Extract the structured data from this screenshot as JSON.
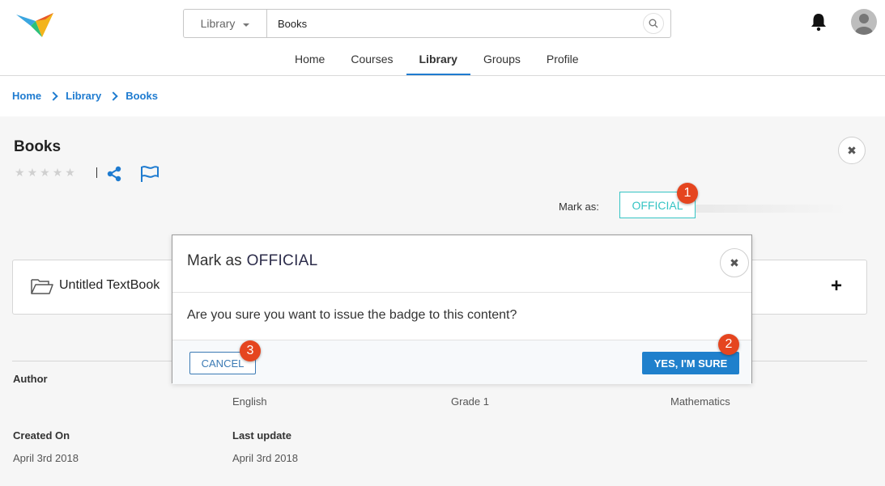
{
  "search": {
    "scope": "Library",
    "query": "Books"
  },
  "nav": {
    "items": [
      "Home",
      "Courses",
      "Library",
      "Groups",
      "Profile"
    ],
    "active": "Library"
  },
  "breadcrumb": [
    "Home",
    "Library",
    "Books"
  ],
  "content": {
    "title": "Books",
    "rating": 0,
    "rating_max": 5,
    "mark_as_label": "Mark as:",
    "badge": "OFFICIAL"
  },
  "card": {
    "title": "Untitled TextBook",
    "add_icon": "plus-icon"
  },
  "meta": {
    "author_label": "Author",
    "language": "English",
    "grade": "Grade 1",
    "subject": "Mathematics",
    "created_label": "Created On",
    "created_value": "April 3rd 2018",
    "updated_label": "Last update",
    "updated_value": "April 3rd 2018"
  },
  "modal": {
    "title_prefix": "Mark as",
    "title_badge": "OFFICIAL",
    "message": "Are you sure you want to issue the badge to this content?",
    "cancel_label": "CANCEL",
    "confirm_label": "YES, I'M SURE"
  },
  "annotations": [
    "1",
    "2",
    "3"
  ],
  "colors": {
    "accent": "#1e7bd0",
    "badge": "#35c4c4",
    "step": "#e5451f",
    "confirm": "#1f80cc"
  }
}
